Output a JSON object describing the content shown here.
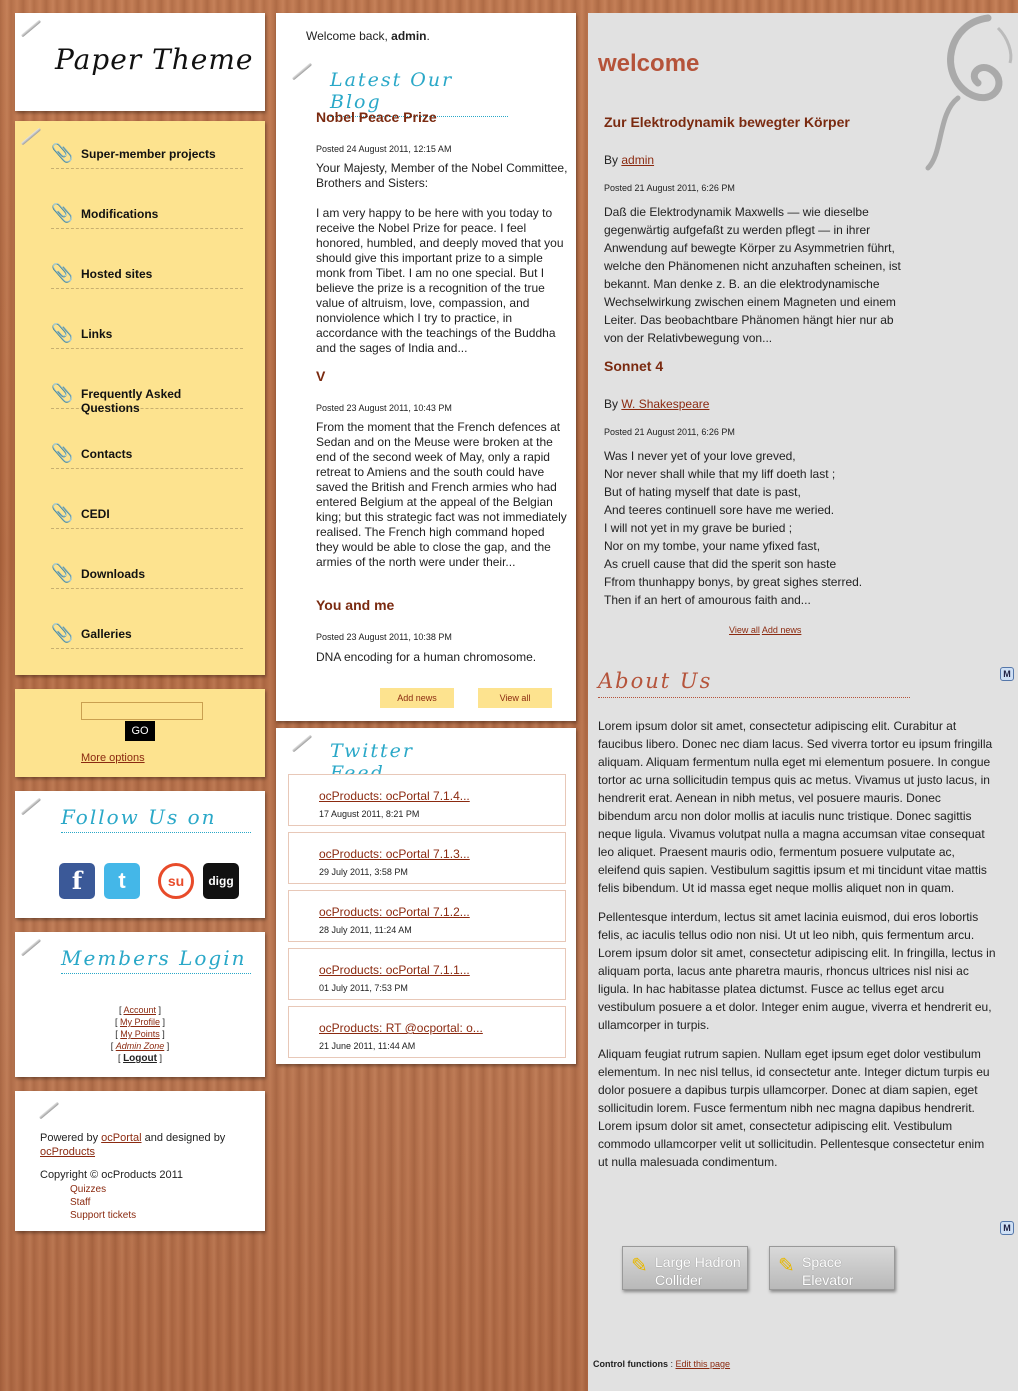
{
  "logo": {
    "text": "Paper Theme"
  },
  "nav": {
    "items": [
      "Super-member projects",
      "Modifications",
      "Hosted sites",
      "Links",
      "Frequently Asked Questions",
      "Contacts",
      "CEDI",
      "Downloads",
      "Galleries"
    ]
  },
  "search": {
    "button": "GO",
    "more": "More options",
    "placeholder": ""
  },
  "follow": {
    "title": "Follow Us on",
    "icons": [
      "facebook-icon",
      "twitter-icon",
      "stumbleupon-icon",
      "digg-icon"
    ],
    "labels": {
      "facebook": "f",
      "twitter": "t",
      "stumbleupon": "su",
      "digg": "digg"
    }
  },
  "login": {
    "title": "Members Login",
    "links": [
      "Account",
      "My Profile",
      "My Points",
      "Admin Zone",
      "Logout"
    ]
  },
  "footer": {
    "powered_prefix": "Powered by",
    "powered_link": "ocPortal",
    "designed": "and designed by",
    "designed_link": "ocProducts",
    "copyright": "Copyright © ocProducts 2011",
    "links": [
      "Quizzes",
      "Staff",
      "Support tickets"
    ]
  },
  "welcome": {
    "prefix": "Welcome back,",
    "user": "admin",
    "suffix": "."
  },
  "blog": {
    "title": "Latest Our Blog",
    "posts": [
      {
        "title": "Nobel Peace Prize",
        "date": "Posted 24 August 2011, 12:15 AM",
        "p1": "Your Majesty, Member of the Nobel Committee, Brothers and Sisters:",
        "p2": "I am very happy to be here with you today to receive the Nobel Prize for peace. I feel honored, humbled, and deeply moved that you should give this important prize to a simple monk from Tibet. I am no one special. But I believe the prize is a recognition of the true value of altruism, love, compassion, and nonviolence which I try to practice, in accordance with the teachings of the Buddha and the sages of India and..."
      },
      {
        "title": "V",
        "date": "Posted 23 August 2011, 10:43 PM",
        "p1": "From the moment that the French defences at Sedan and on the Meuse were broken at the end of the second week of May, only a rapid retreat to Amiens and the south could have saved the British and French armies who had entered Belgium at the appeal of the Belgian king; but this strategic fact was not immediately realised. The French high command hoped they would be able to close the gap, and the armies of the north were under their..."
      },
      {
        "title": "You and me",
        "date": "Posted 23 August 2011, 10:38 PM",
        "p1": "DNA encoding for a human chromosome."
      }
    ],
    "add": "Add news",
    "view": "View all"
  },
  "twitter": {
    "title": "Twitter Feed",
    "items": [
      {
        "text": "ocProducts: ocPortal 7.1.4...",
        "date": "17 August 2011, 8:21 PM"
      },
      {
        "text": "ocProducts: ocPortal 7.1.3...",
        "date": "29 July 2011, 3:58 PM"
      },
      {
        "text": "ocProducts: ocPortal 7.1.2...",
        "date": "28 July 2011, 11:24 AM"
      },
      {
        "text": "ocProducts: ocPortal 7.1.1...",
        "date": "01 July 2011, 7:53 PM"
      },
      {
        "text": "ocProducts: RT @ocportal: o...",
        "date": "21 June 2011, 11:44 AM"
      }
    ]
  },
  "main": {
    "heading": "welcome",
    "news": [
      {
        "title": "Zur Elektrodynamik bewegter Körper",
        "by": "By",
        "author": "admin",
        "date": "Posted 21 August 2011, 6:26 PM",
        "lines": [
          "Daß die Elektrodynamik Maxwells — wie dieselbe",
          "gegenwärtig aufgefaßt zu werden pflegt — in ihrer",
          "Anwendung auf bewegte Körper zu Asymmetrien führt,",
          "welche den Phänomenen nicht anzuhaften scheinen, ist",
          "bekannt. Man denke z. B. an die elektrodynamische",
          "Wechselwirkung zwischen einem Magneten und einem",
          "Leiter. Das beobachtbare Phänomen hängt hier nur ab",
          "von der Relativbewegung von..."
        ]
      },
      {
        "title": "Sonnet 4",
        "by": "By",
        "author": "W. Shakespeare",
        "date": "Posted 21 August 2011, 6:26 PM",
        "lines": [
          "Was I never yet of your love greved,",
          "Nor never shall while that my liff doeth last ;",
          "But of hating myself that date is past,",
          "And teeres continuell sore have me weried.",
          "I will not yet in my grave be buried ;",
          "Nor on my tombe, your name yfixed fast,",
          "As cruell cause that did the sperit son haste",
          "Ffrom thunhappy bonys, by great sighes sterred.",
          "Then if an hert of amourous faith and..."
        ]
      }
    ],
    "view_all": "View all",
    "add_news": "Add news",
    "about_title": "About Us",
    "about": [
      "Lorem ipsum dolor sit amet, consectetur adipiscing elit. Curabitur at faucibus libero. Donec nec diam lacus. Sed viverra tortor eu ipsum fringilla aliquam. Aliquam fermentum nulla eget mi elementum posuere. In congue tortor ac urna sollicitudin tempus quis ac metus. Vivamus ut justo lacus, in hendrerit erat. Aenean in nibh metus, vel posuere mauris. Donec bibendum arcu non dolor mollis at iaculis nunc tristique. Donec sagittis neque ligula. Vivamus volutpat nulla a magna accumsan vitae consequat leo aliquet. Praesent mauris odio, fermentum posuere vulputate ac, eleifend quis sapien. Vestibulum sagittis ipsum et mi tincidunt vitae mattis felis bibendum. Ut id massa eget neque mollis aliquet non in quam.",
      "Pellentesque interdum, lectus sit amet lacinia euismod, dui eros lobortis felis, ac iaculis tellus odio non nisi. Ut ut leo nibh, quis fermentum arcu. Lorem ipsum dolor sit amet, consectetur adipiscing elit. In fringilla, lectus in aliquam porta, lacus ante pharetra mauris, rhoncus ultrices nisl nisi ac ligula. In hac habitasse platea dictumst. Fusce ac tellus eget arcu vestibulum posuere a et dolor. Integer enim augue, viverra et hendrerit eu, ullamcorper in turpis.",
      "Aliquam feugiat rutrum sapien. Nullam eget ipsum eget dolor vestibulum elementum. In nec nisl tellus, id consectetur ante. Integer dictum turpis eu dolor posuere a dapibus turpis ullamcorper. Donec at diam sapien, eget sollicitudin lorem. Fusce fermentum nibh nec magna dapibus hendrerit. Lorem ipsum dolor sit amet, consectetur adipiscing elit. Vestibulum commodo ullamcorper velit ut sollicitudin. Pellentesque consectetur enim ut nulla malesuada condimentum."
    ],
    "buttons": [
      {
        "line1": "Large Hadron",
        "line2": "Collider"
      },
      {
        "line1": "Space",
        "line2": "Elevator"
      }
    ],
    "control_label": "Control functions",
    "control_link": "Edit this page"
  }
}
